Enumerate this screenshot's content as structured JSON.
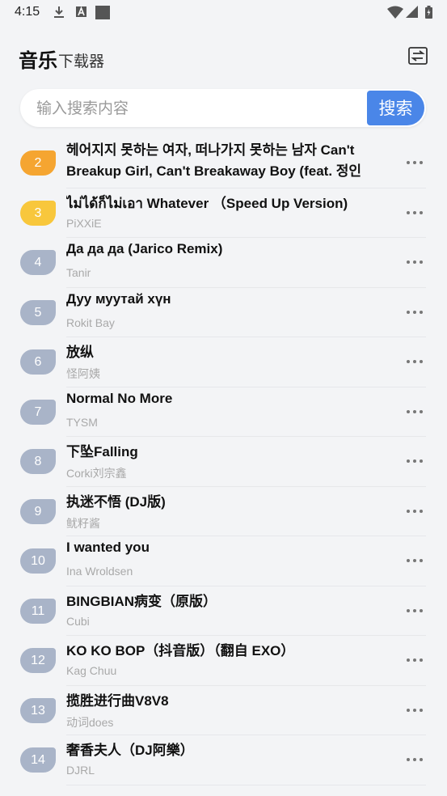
{
  "status_bar": {
    "time": "4:15"
  },
  "header": {
    "title_main": "音乐",
    "title_sub": "下载器"
  },
  "search": {
    "placeholder": "输入搜索内容",
    "button_label": "搜索"
  },
  "songs": [
    {
      "rank": "2",
      "title": "헤어지지 못하는 여자, 떠나가지 못하는 남자 Can't Breakup Girl, Can't Breakaway Boy (feat. 정인",
      "artist": ""
    },
    {
      "rank": "3",
      "title": "ไม่ได้ก็ไม่เอา Whatever （Speed Up Version)",
      "artist": "PiXXiE"
    },
    {
      "rank": "4",
      "title": "Да да да (Jarico Remix)",
      "artist": "Tanir"
    },
    {
      "rank": "5",
      "title": "Дуу муутай хүн",
      "artist": "Rokit Bay"
    },
    {
      "rank": "6",
      "title": "放纵",
      "artist": "怪阿姨"
    },
    {
      "rank": "7",
      "title": "Normal No More",
      "artist": "TYSM"
    },
    {
      "rank": "8",
      "title": "下坠Falling",
      "artist": "Corki刘宗鑫"
    },
    {
      "rank": "9",
      "title": "执迷不悟 (DJ版)",
      "artist": "鱿籽酱"
    },
    {
      "rank": "10",
      "title": "I wanted you",
      "artist": "Ina Wroldsen"
    },
    {
      "rank": "11",
      "title": "BINGBIAN病变（原版）",
      "artist": "Cubi"
    },
    {
      "rank": "12",
      "title": "KO KO BOP（抖音版）（翻自 EXO）",
      "artist": "Kag Chuu"
    },
    {
      "rank": "13",
      "title": "揽胜进行曲V8V8",
      "artist": "动词does"
    },
    {
      "rank": "14",
      "title": "奢香夫人（DJ阿樂）",
      "artist": "DJRL"
    }
  ],
  "colors": {
    "accent": "#4a86e8",
    "rank_default": "#a9b4c8",
    "rank_gold": "#f8c73c",
    "rank_orange": "#f5a531"
  },
  "icons": {
    "status": [
      "download-icon",
      "font-icon",
      "square-icon",
      "wifi-icon",
      "signal-icon",
      "battery-icon"
    ],
    "header": "swap-icon",
    "row": "more-dots-icon"
  }
}
